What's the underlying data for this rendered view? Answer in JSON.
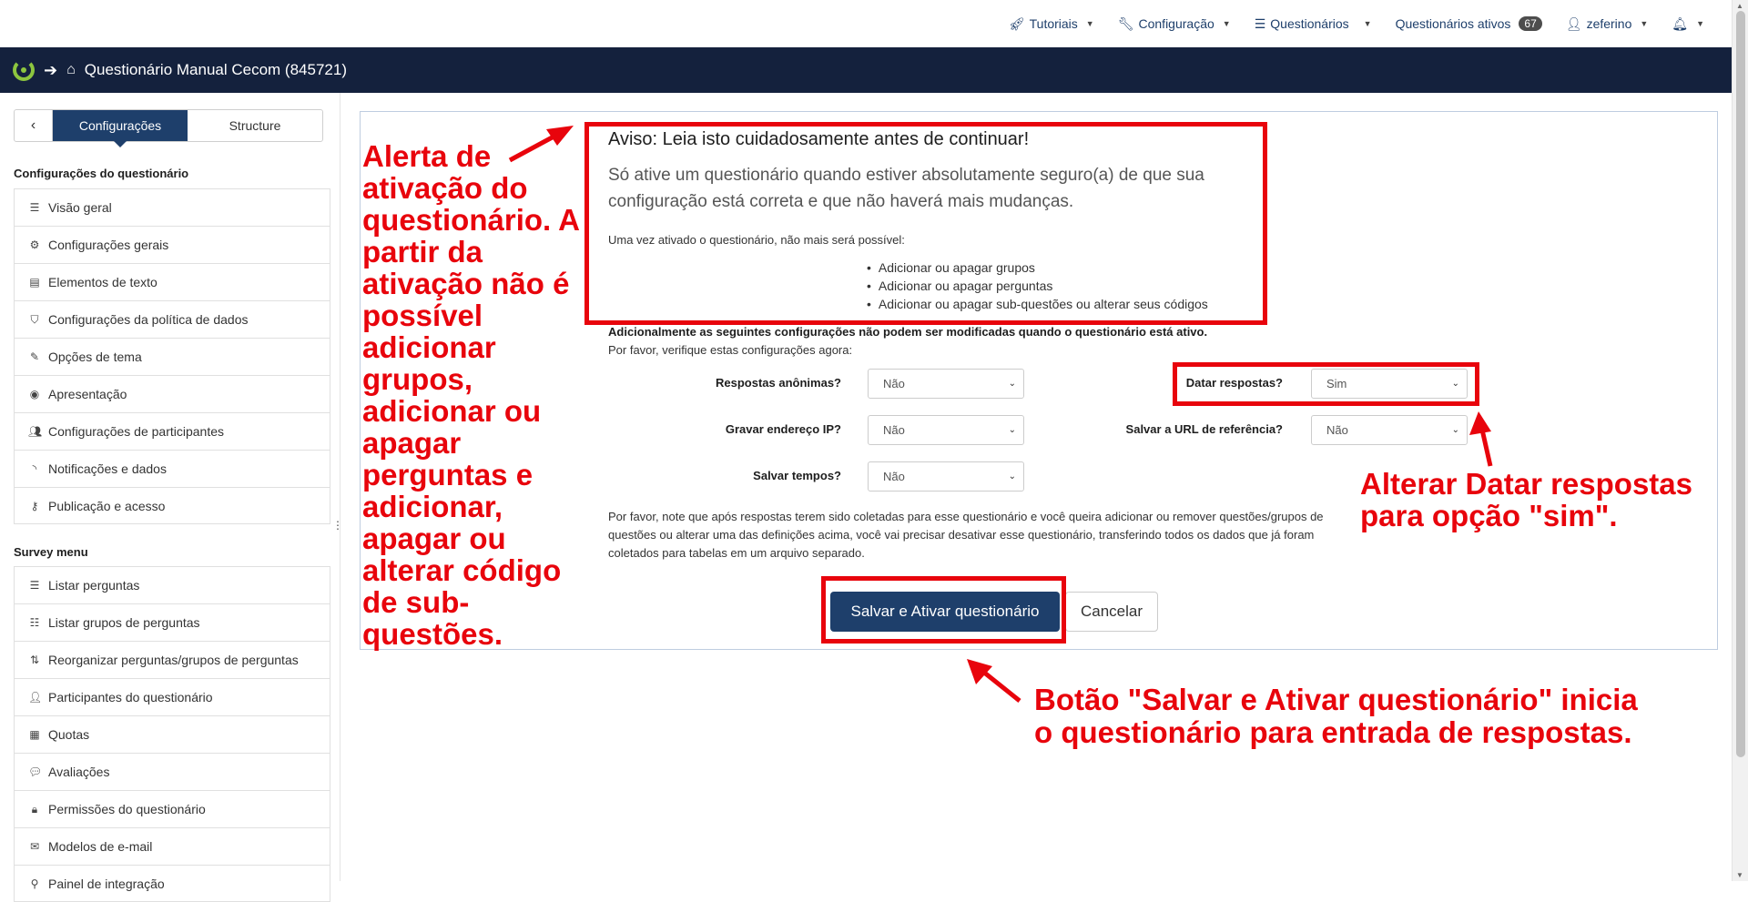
{
  "topnav": {
    "tutorials": "Tutoriais",
    "config": "Configuração",
    "surveys": "Questionários",
    "active_surveys": "Questionários ativos",
    "active_count": "67",
    "user": "zeferino"
  },
  "titlebar": {
    "title": "Questionário Manual Cecom (845721)"
  },
  "sidebar": {
    "tab_settings": "Configurações",
    "tab_structure": "Structure",
    "section1_title": "Configurações do questionário",
    "section1_items": [
      {
        "label": "Visão geral",
        "icon": "list-icon"
      },
      {
        "label": "Configurações gerais",
        "icon": "gears-icon"
      },
      {
        "label": "Elementos de texto",
        "icon": "file-text-icon"
      },
      {
        "label": "Configurações da política de dados",
        "icon": "shield-icon"
      },
      {
        "label": "Opções de tema",
        "icon": "paint-brush-icon"
      },
      {
        "label": "Apresentação",
        "icon": "eye-slash-icon"
      },
      {
        "label": "Configurações de participantes",
        "icon": "users-icon"
      },
      {
        "label": "Notificações e dados",
        "icon": "feed-icon"
      },
      {
        "label": "Publicação e acesso",
        "icon": "key-icon"
      }
    ],
    "section2_title": "Survey menu",
    "section2_items": [
      {
        "label": "Listar perguntas",
        "icon": "list-icon"
      },
      {
        "label": "Listar grupos de perguntas",
        "icon": "th-list-icon"
      },
      {
        "label": "Reorganizar perguntas/grupos de perguntas",
        "icon": "sort-icon"
      },
      {
        "label": "Participantes do questionário",
        "icon": "user-icon"
      },
      {
        "label": "Quotas",
        "icon": "tasks-icon"
      },
      {
        "label": "Avaliações",
        "icon": "comment-icon"
      },
      {
        "label": "Permissões do questionário",
        "icon": "lock-icon"
      },
      {
        "label": "Modelos de e-mail",
        "icon": "envelope-icon"
      },
      {
        "label": "Painel de integração",
        "icon": "plug-icon"
      }
    ]
  },
  "warning": {
    "title": "Aviso: Leia isto cuidadosamente antes de continuar!",
    "lead": "Só ative um questionário quando estiver absolutamente seguro(a) de que sua configuração está correta e que não haverá mais mudanças.",
    "sub": "Uma vez ativado o questionário, não mais será possível:",
    "items": [
      "Adicionar ou apagar grupos",
      "Adicionar ou apagar perguntas",
      "Adicionar ou apagar sub-questões ou alterar seus códigos"
    ]
  },
  "settings": {
    "additional_bold": "Adicionalmente as seguintes configurações não podem ser modificadas quando o questionário está ativo.",
    "additional_note": "Por favor, verifique estas configurações agora:",
    "anonymous_label": "Respostas anônimas?",
    "anonymous_value": "Não",
    "ip_label": "Gravar endereço IP?",
    "ip_value": "Não",
    "timings_label": "Salvar tempos?",
    "timings_value": "Não",
    "date_label": "Datar respostas?",
    "date_value": "Sim",
    "referrer_label": "Salvar a URL de referência?",
    "referrer_value": "Não",
    "bottom_note": "Por favor, note que após respostas terem sido coletadas para esse questionário e você queira adicionar ou remover questões/grupos de questões ou alterar uma das definições acima, você vai precisar desativar esse questionário, transferindo todos os dados que já foram coletados para tabelas em um arquivo separado."
  },
  "buttons": {
    "save_activate": "Salvar e Ativar questionário",
    "cancel": "Cancelar"
  },
  "annotations": {
    "left_text": "Alerta de ativação do questionário. A partir da ativação não é possível adicionar grupos, adicionar ou apagar perguntas e adicionar, apagar ou alterar código de sub-questões.",
    "right_line1": "Alterar Datar respostas",
    "right_line2": "para opção \"sim\".",
    "bottom_line1": "Botão \"Salvar e Ativar questionário\" inicia",
    "bottom_line2": "o questionário para entrada de respostas.",
    "color": "#e8040c"
  },
  "colors": {
    "brand_dark": "#14213d",
    "primary": "#1e3f6b",
    "logo_green": "#8dc63f"
  }
}
